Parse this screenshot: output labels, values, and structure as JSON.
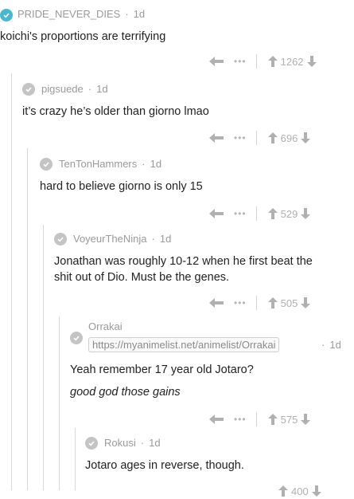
{
  "colors": {
    "accent": "#49b8cf",
    "muted": "#b5b5b5"
  },
  "comments": [
    {
      "user": "PRIDE_NEVER_DIES",
      "age": "1d",
      "text": "koichi's proportions are terrifying",
      "score": "1262"
    },
    {
      "user": "pigsuede",
      "age": "1d",
      "text": "it’s crazy he’s older than giorno lmao",
      "score": "696"
    },
    {
      "user": "TenTonHammers",
      "age": "1d",
      "text": "hard to believe giorno is only 15",
      "score": "529"
    },
    {
      "user": "VoyeurTheNinja",
      "age": "1d",
      "text_line1": "Jonathan was roughly 10-12 when he first beat the",
      "text_line2": "shit out of Dio. Must be the genes.",
      "score": "505"
    },
    {
      "user": "Orrakai",
      "flair": "https://myanimelist.net/animelist/Orrakai",
      "age": "1d",
      "text": "Yeah remember 17 year old Jotaro?",
      "text_italic": "good god those gains",
      "score": "575"
    },
    {
      "user": "Rokusi",
      "age": "1d",
      "text": "Jotaro ages in reverse, though.",
      "score": "400"
    }
  ]
}
